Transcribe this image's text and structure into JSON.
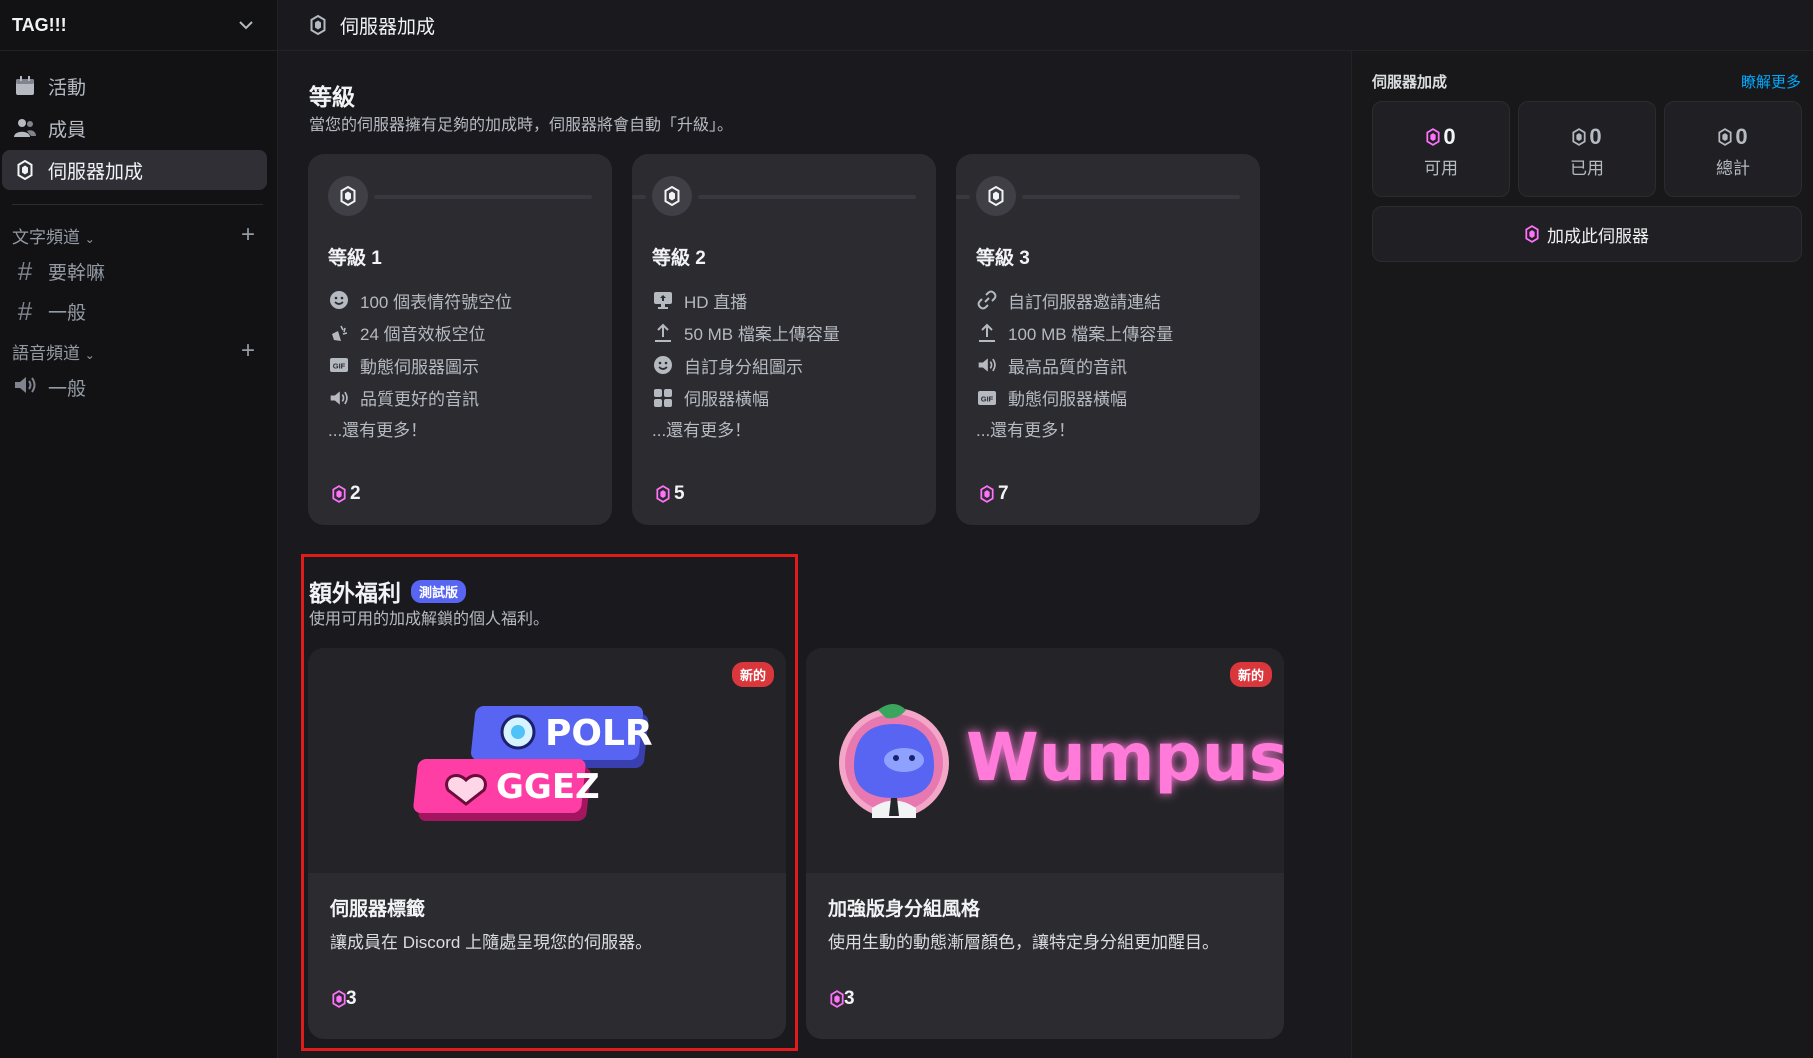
{
  "server": {
    "name": "TAG!!!"
  },
  "sidebar": {
    "nav": [
      {
        "label": "活動",
        "icon": "calendar-icon"
      },
      {
        "label": "成員",
        "icon": "members-icon"
      },
      {
        "label": "伺服器加成",
        "icon": "boost-gem-icon",
        "active": true
      }
    ],
    "text_category": "文字頻道",
    "text_channels": [
      "要幹嘛",
      "一般"
    ],
    "voice_category": "語音頻道",
    "voice_channels": [
      "一般"
    ]
  },
  "topbar": {
    "title": "伺服器加成"
  },
  "levels_section": {
    "title": "等級",
    "subtitle": "當您的伺服器擁有足夠的加成時，伺服器將會自動「升級」。",
    "more_label": "...還有更多！",
    "levels": [
      {
        "title": "等級 1",
        "cost": "2",
        "perks": [
          {
            "label": "100 個表情符號空位",
            "icon": "emoji-icon"
          },
          {
            "label": "24 個音效板空位",
            "icon": "soundboard-icon"
          },
          {
            "label": "動態伺服器圖示",
            "icon": "gif-icon"
          },
          {
            "label": "品質更好的音訊",
            "icon": "speaker-icon"
          }
        ]
      },
      {
        "title": "等級 2",
        "cost": "5",
        "perks": [
          {
            "label": "HD 直播",
            "icon": "stream-icon"
          },
          {
            "label": "50 MB 檔案上傳容量",
            "icon": "upload-icon"
          },
          {
            "label": "自訂身分組圖示",
            "icon": "emoji-icon"
          },
          {
            "label": "伺服器橫幅",
            "icon": "grid-icon"
          }
        ]
      },
      {
        "title": "等級 3",
        "cost": "7",
        "perks": [
          {
            "label": "自訂伺服器邀請連結",
            "icon": "link-icon"
          },
          {
            "label": "100 MB 檔案上傳容量",
            "icon": "upload-icon"
          },
          {
            "label": "最高品質的音訊",
            "icon": "speaker-icon"
          },
          {
            "label": "動態伺服器橫幅",
            "icon": "gif-icon"
          }
        ]
      }
    ]
  },
  "perks_section": {
    "title": "額外福利",
    "beta_badge": "測試版",
    "subtitle": "使用可用的加成解鎖的個人福利。",
    "new_badge": "新的",
    "cards": [
      {
        "title": "伺服器標籤",
        "description": "讓成員在 Discord 上隨處呈現您的伺服器。",
        "cost": "3",
        "art": {
          "tag1": "POLR",
          "tag2": "GGEZ"
        }
      },
      {
        "title": "加強版身分組風格",
        "description": "使用生動的動態漸層顏色，讓特定身分組更加醒目。",
        "cost": "3",
        "art": {
          "word": "Wumpus"
        }
      }
    ]
  },
  "right_panel": {
    "title": "伺服器加成",
    "learn_more": "瞭解更多",
    "stats": [
      {
        "value": "0",
        "label": "可用"
      },
      {
        "value": "0",
        "label": "已用"
      },
      {
        "value": "0",
        "label": "總計"
      }
    ],
    "boost_button": "加成此伺服器"
  },
  "colors": {
    "accent_pink": "#ff73fa",
    "blurple": "#5865f2",
    "new_red": "#da373c",
    "link_blue": "#00a8fc"
  }
}
